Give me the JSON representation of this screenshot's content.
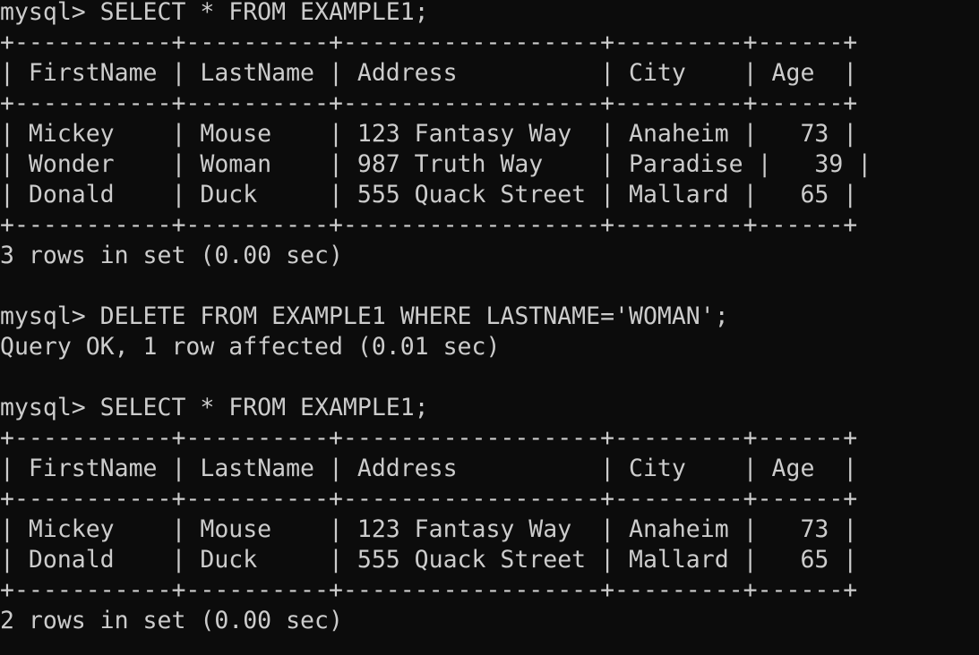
{
  "terminal": {
    "colors": {
      "background": "#0c0c0c",
      "foreground": "#cccccc"
    },
    "lines": [
      "mysql> SELECT * FROM EXAMPLE1;",
      "+-----------+----------+------------------+---------+------+",
      "| FirstName | LastName | Address          | City    | Age  |",
      "+-----------+----------+------------------+---------+------+",
      "| Mickey    | Mouse    | 123 Fantasy Way  | Anaheim |   73 |",
      "| Wonder    | Woman    | 987 Truth Way    | Paradise |   39 |",
      "| Donald    | Duck     | 555 Quack Street | Mallard |   65 |",
      "+-----------+----------+------------------+---------+------+",
      "3 rows in set (0.00 sec)",
      "",
      "mysql> DELETE FROM EXAMPLE1 WHERE LASTNAME='WOMAN';",
      "Query OK, 1 row affected (0.01 sec)",
      "",
      "mysql> SELECT * FROM EXAMPLE1;",
      "+-----------+----------+------------------+---------+------+",
      "| FirstName | LastName | Address          | City    | Age  |",
      "+-----------+----------+------------------+---------+------+",
      "| Mickey    | Mouse    | 123 Fantasy Way  | Anaheim |   73 |",
      "| Donald    | Duck     | 555 Quack Street | Mallard |   65 |",
      "+-----------+----------+------------------+---------+------+",
      "2 rows in set (0.00 sec)",
      ""
    ]
  }
}
